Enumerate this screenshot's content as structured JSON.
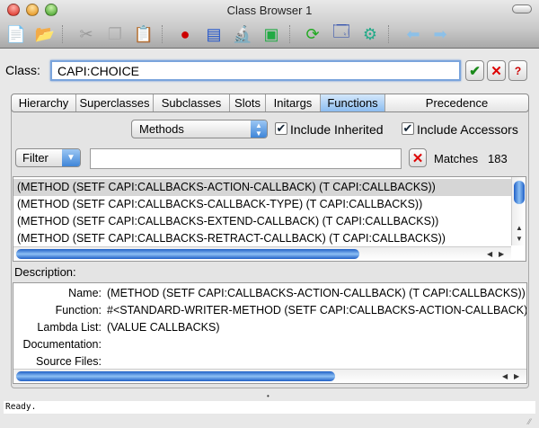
{
  "window": {
    "title": "Class Browser 1"
  },
  "toolbar": {
    "icons": [
      "new-file-icon",
      "open-folder-icon",
      "cut-icon",
      "copy-icon",
      "paste-icon",
      "inspect-icon",
      "listener-icon",
      "microscope-icon",
      "class-graph-icon",
      "refresh-icon",
      "windows-icon",
      "tools-icon",
      "back-arrow-icon",
      "forward-arrow-icon"
    ]
  },
  "class_field": {
    "label": "Class:",
    "value": "CAPI:CHOICE"
  },
  "tabs": [
    {
      "label": "Hierarchy"
    },
    {
      "label": "Superclasses"
    },
    {
      "label": "Subclasses"
    },
    {
      "label": "Slots"
    },
    {
      "label": "Initargs"
    },
    {
      "label": "Functions",
      "active": true
    },
    {
      "label": "Precedence"
    }
  ],
  "options": {
    "kind_select": "Methods",
    "include_inherited": {
      "label": "Include Inherited",
      "checked": true
    },
    "include_accessors": {
      "label": "Include Accessors",
      "checked": true
    }
  },
  "filter": {
    "label": "Filter",
    "value": "",
    "matches_label": "Matches",
    "matches_count": "183"
  },
  "list": {
    "items": [
      "(METHOD (SETF CAPI:CALLBACKS-ACTION-CALLBACK) (T CAPI:CALLBACKS))",
      "(METHOD (SETF CAPI:CALLBACKS-CALLBACK-TYPE) (T CAPI:CALLBACKS))",
      "(METHOD (SETF CAPI:CALLBACKS-EXTEND-CALLBACK) (T CAPI:CALLBACKS))",
      "(METHOD (SETF CAPI:CALLBACKS-RETRACT-CALLBACK) (T CAPI:CALLBACKS))"
    ],
    "selected_index": 0
  },
  "description": {
    "label": "Description:",
    "fields": [
      {
        "key": "Name:",
        "value": "(METHOD (SETF CAPI:CALLBACKS-ACTION-CALLBACK) (T CAPI:CALLBACKS))"
      },
      {
        "key": "Function:",
        "value": "#<STANDARD-WRITER-METHOD (SETF CAPI:CALLBACKS-ACTION-CALLBACK) (T CAPI:CALLBACKS)"
      },
      {
        "key": "Lambda List:",
        "value": "(VALUE CALLBACKS)"
      },
      {
        "key": "Documentation:",
        "value": ""
      },
      {
        "key": "Source Files:",
        "value": ""
      }
    ]
  },
  "status": {
    "text": "Ready."
  }
}
